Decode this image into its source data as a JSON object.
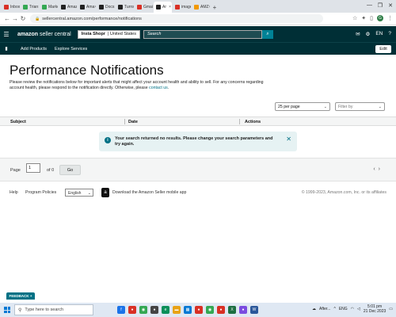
{
  "browser": {
    "tabs": [
      {
        "label": "Inbox",
        "color": "#d93025",
        "active": false
      },
      {
        "label": "Trian",
        "color": "#34a853",
        "active": false
      },
      {
        "label": "Marke",
        "color": "#34a853",
        "active": false
      },
      {
        "label": "Amaz",
        "color": "#222222",
        "active": false
      },
      {
        "label": "Ama",
        "color": "#222222",
        "active": false
      },
      {
        "label": "Docs",
        "color": "#222222",
        "active": false
      },
      {
        "label": "Turns",
        "color": "#222222",
        "active": false
      },
      {
        "label": "Gmail",
        "color": "#d93025",
        "active": false
      },
      {
        "label": "Ar",
        "color": "#222222",
        "active": true
      },
      {
        "label": "image",
        "color": "#d93025",
        "active": false
      },
      {
        "label": "AMZ",
        "color": "#f29900",
        "active": false
      }
    ],
    "url": "sellercentral.amazon.com/performance/notifications",
    "avatar_letter": "G"
  },
  "header": {
    "logo_main": "amazon",
    "logo_sub": " seller central",
    "store_name": "Insta Shopr",
    "store_region": "| United States",
    "search_placeholder": "Search",
    "lang": "EN"
  },
  "subnav": {
    "items": [
      "Add Products",
      "Explore Services"
    ],
    "edit_label": "Edit"
  },
  "main": {
    "title": "Performance Notifications",
    "intro_text": "Please review the notifications below for important alerts that might affect your account health and ability to sell. For any concerns regarding account health, please respond to the notification directly. Otherwise, please ",
    "intro_link": "contact us",
    "intro_end": ".",
    "per_page": "25 per page",
    "filter_placeholder": "Filter by",
    "columns": [
      "Subject",
      "Date",
      "Actions"
    ],
    "alert_message": "Your search returned no results. Please change your search parameters and try again.",
    "pager": {
      "page_label": "Page",
      "page_value": "1",
      "of_label": "of 0",
      "go_label": "Go"
    }
  },
  "footer": {
    "help": "Help",
    "program_policies": "Program Policies",
    "language": "English",
    "app_text": "Download the Amazon Seller mobile app",
    "copyright": "© 1999-2023, Amazon.com, Inc. or its affiliates"
  },
  "feedback_label": "FEEDBACK",
  "taskbar": {
    "search_placeholder": "Type here to search",
    "weather": "After...",
    "lang": "ENG",
    "time": "5:01 pm",
    "date": "21 Dec 2023"
  }
}
